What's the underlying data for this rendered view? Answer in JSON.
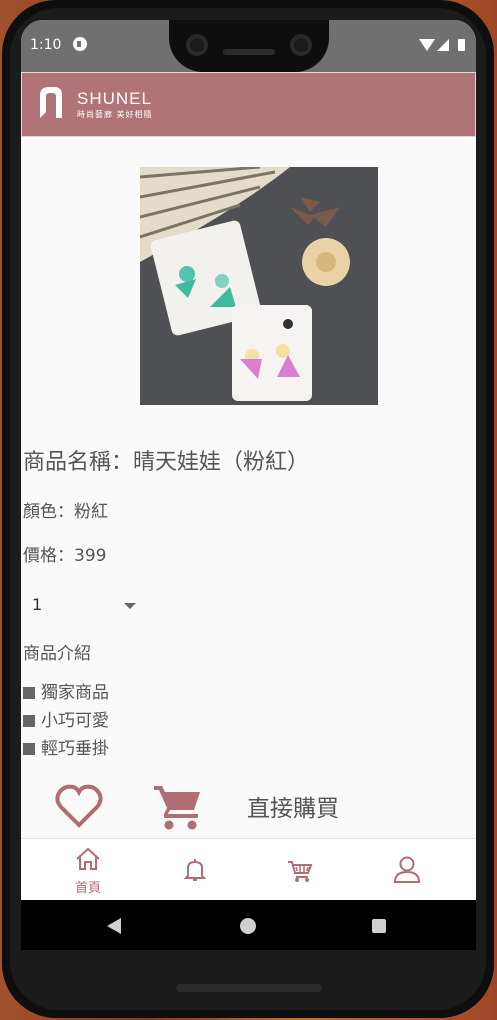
{
  "status_bar": {
    "time": "1:10"
  },
  "app_bar": {
    "logo_text": "SHUNEL",
    "logo_sub": "時尚藝廊 美好相隨"
  },
  "product": {
    "name": "商品名稱：晴天娃娃（粉紅）",
    "color": "顏色：粉紅",
    "price": "價格：399",
    "quantity": "1",
    "intro_title": "商品介紹",
    "features": [
      "獨家商品",
      "小巧可愛",
      "輕巧垂掛"
    ]
  },
  "actions": {
    "buy_now": "直接購買"
  },
  "bottom_nav": {
    "home_label": "首頁"
  },
  "colors": {
    "brand": "#b07478",
    "accent": "#b06e74"
  },
  "icons": [
    "heart-icon",
    "cart-icon",
    "home-icon",
    "bell-icon",
    "user-icon"
  ]
}
